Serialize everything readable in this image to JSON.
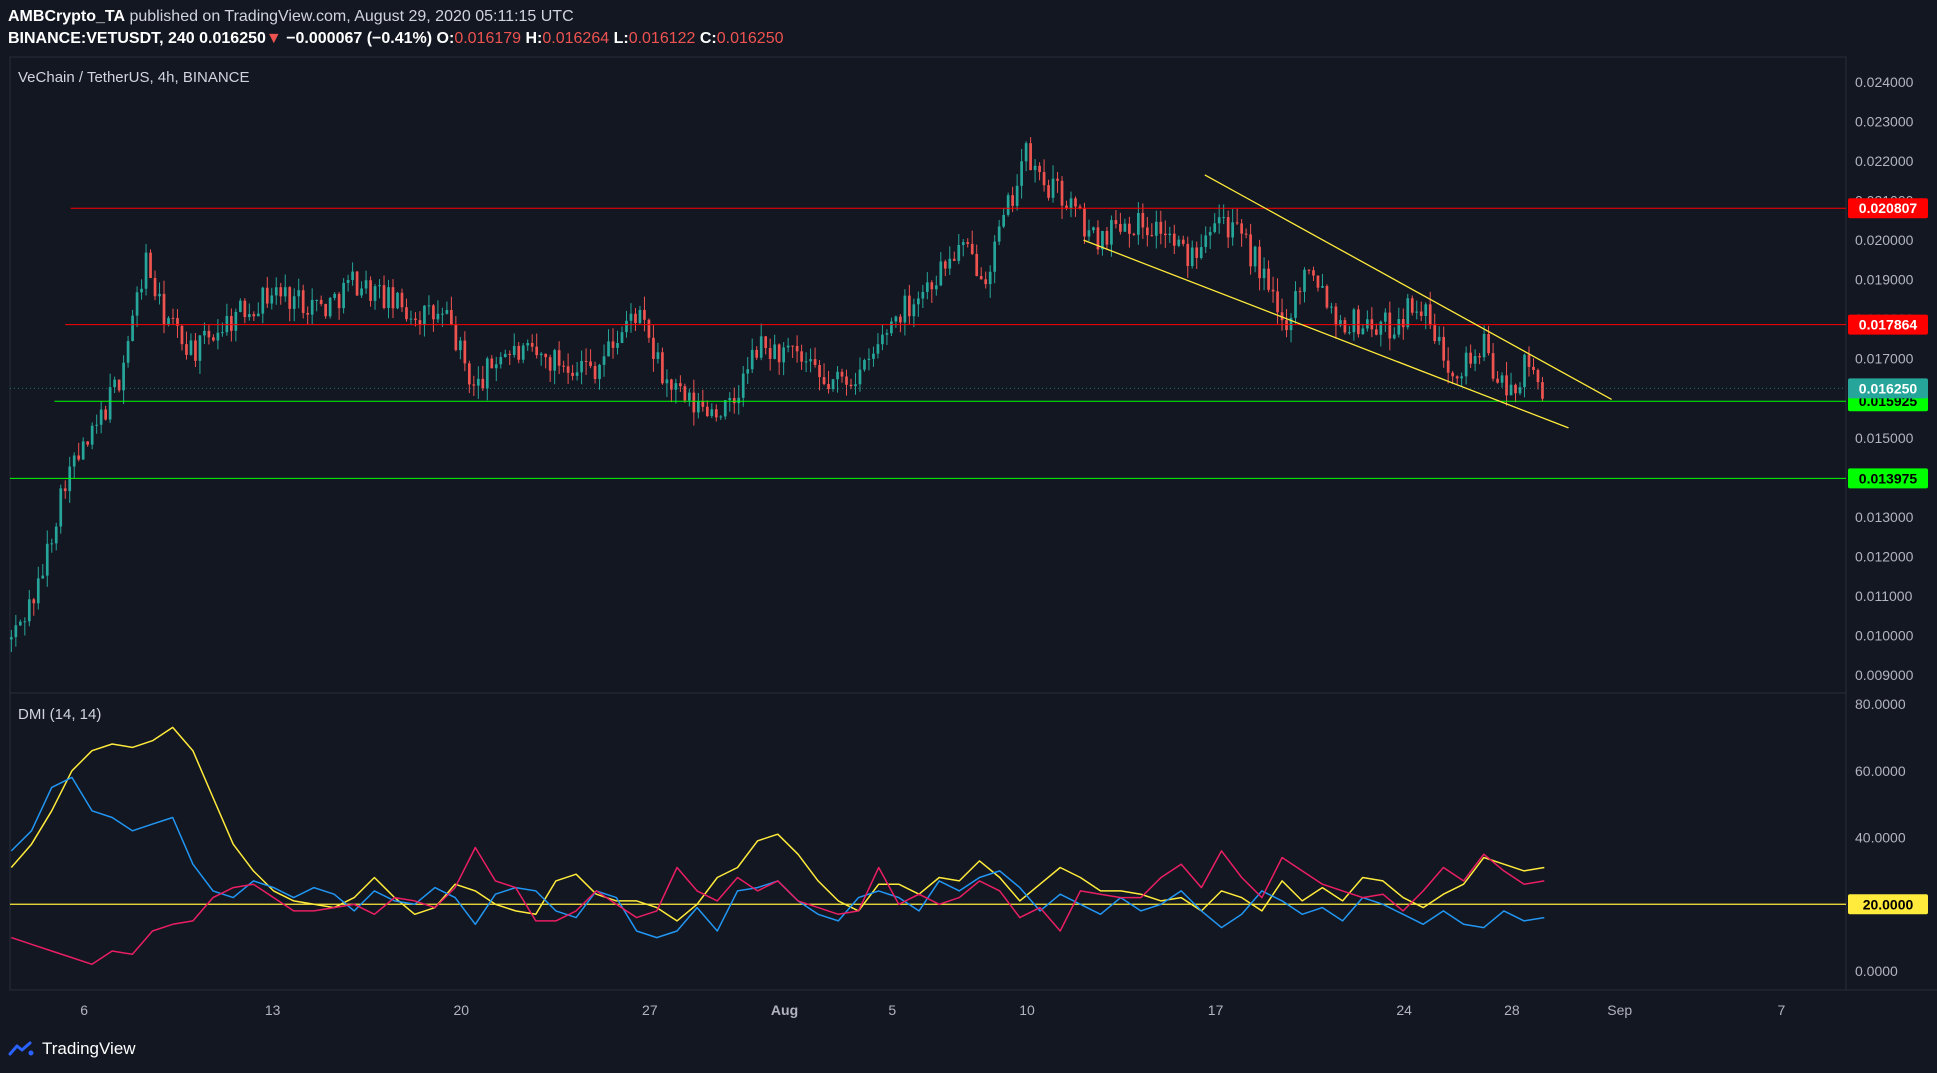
{
  "header": {
    "author": "AMBCrypto_TA",
    "published_text": "published on TradingView.com, August 29, 2020 05:11:15 UTC",
    "symbol": "BINANCE:VETUSDT, 240",
    "last": "0.016250",
    "arrow": "▼",
    "change": "−0.000067 (−0.41%)",
    "o_label": "O:",
    "o": "0.016179",
    "h_label": "H:",
    "h": "0.016264",
    "l_label": "L:",
    "l": "0.016122",
    "c_label": "C:",
    "c": "0.016250"
  },
  "footer": {
    "brand": "TradingView"
  },
  "chart_data": [
    {
      "type": "candlestick",
      "title": "VeChain / TetherUS, 4h, BINANCE",
      "ylim": [
        0.0085,
        0.0247
      ],
      "y_ticks": [
        "0.024000",
        "0.023000",
        "0.022000",
        "0.021000",
        "0.020000",
        "0.019000",
        "0.018000",
        "0.017000",
        "0.016000",
        "0.015000",
        "0.014000",
        "0.013000",
        "0.012000",
        "0.011000",
        "0.010000",
        "0.009000"
      ],
      "x_ticks": [
        {
          "label": "6",
          "day": 6
        },
        {
          "label": "13",
          "day": 13
        },
        {
          "label": "20",
          "day": 20
        },
        {
          "label": "27",
          "day": 27
        },
        {
          "label": "Aug",
          "day": 32
        },
        {
          "label": "5",
          "day": 36
        },
        {
          "label": "10",
          "day": 41
        },
        {
          "label": "17",
          "day": 48
        },
        {
          "label": "24",
          "day": 55
        },
        {
          "label": "28",
          "day": 59
        },
        {
          "label": "Sep",
          "day": 63
        },
        {
          "label": "7",
          "day": 69
        }
      ],
      "x_range_days": [
        3.25,
        71.4
      ],
      "up_color": "#26a69a",
      "down_color": "#ef5350",
      "key_points": [
        {
          "day": 3.3,
          "price": 0.0099
        },
        {
          "day": 4.3,
          "price": 0.0112
        },
        {
          "day": 5.3,
          "price": 0.014
        },
        {
          "day": 6.3,
          "price": 0.015
        },
        {
          "day": 7.3,
          "price": 0.0165
        },
        {
          "day": 8.3,
          "price": 0.0195
        },
        {
          "day": 8.8,
          "price": 0.0183
        },
        {
          "day": 9.6,
          "price": 0.0175
        },
        {
          "day": 10.2,
          "price": 0.0172
        },
        {
          "day": 11.0,
          "price": 0.0178
        },
        {
          "day": 13.0,
          "price": 0.0187
        },
        {
          "day": 15.0,
          "price": 0.0183
        },
        {
          "day": 16.0,
          "price": 0.019
        },
        {
          "day": 18.0,
          "price": 0.0182
        },
        {
          "day": 19.5,
          "price": 0.018
        },
        {
          "day": 20.5,
          "price": 0.0162
        },
        {
          "day": 21.5,
          "price": 0.0172
        },
        {
          "day": 23.0,
          "price": 0.017
        },
        {
          "day": 25.0,
          "price": 0.0168
        },
        {
          "day": 26.5,
          "price": 0.0182
        },
        {
          "day": 27.5,
          "price": 0.0165
        },
        {
          "day": 28.5,
          "price": 0.0158
        },
        {
          "day": 30.0,
          "price": 0.0157
        },
        {
          "day": 31.0,
          "price": 0.0173
        },
        {
          "day": 32.5,
          "price": 0.017
        },
        {
          "day": 33.5,
          "price": 0.0163
        },
        {
          "day": 35.0,
          "price": 0.0167
        },
        {
          "day": 36.0,
          "price": 0.018
        },
        {
          "day": 37.5,
          "price": 0.019
        },
        {
          "day": 38.5,
          "price": 0.0198
        },
        {
          "day": 39.5,
          "price": 0.0192
        },
        {
          "day": 40.4,
          "price": 0.021
        },
        {
          "day": 40.9,
          "price": 0.0222
        },
        {
          "day": 41.5,
          "price": 0.0215
        },
        {
          "day": 42.5,
          "price": 0.021
        },
        {
          "day": 43.5,
          "price": 0.02
        },
        {
          "day": 44.5,
          "price": 0.0205
        },
        {
          "day": 46.0,
          "price": 0.0203
        },
        {
          "day": 47.0,
          "price": 0.0195
        },
        {
          "day": 48.0,
          "price": 0.0208
        },
        {
          "day": 49.5,
          "price": 0.0195
        },
        {
          "day": 50.5,
          "price": 0.0178
        },
        {
          "day": 51.5,
          "price": 0.0195
        },
        {
          "day": 52.5,
          "price": 0.018
        },
        {
          "day": 54.5,
          "price": 0.0178
        },
        {
          "day": 55.5,
          "price": 0.0185
        },
        {
          "day": 56.5,
          "price": 0.017
        },
        {
          "day": 57.0,
          "price": 0.0168
        },
        {
          "day": 58.0,
          "price": 0.0173
        },
        {
          "day": 58.8,
          "price": 0.016
        },
        {
          "day": 59.5,
          "price": 0.0168
        },
        {
          "day": 60.2,
          "price": 0.01625
        }
      ],
      "lines": [
        {
          "name": "resistance-1",
          "price": 0.020807,
          "label": "0.020807",
          "color": "#ff0000",
          "from_day": 5.5
        },
        {
          "name": "resistance-2",
          "price": 0.017864,
          "label": "0.017864",
          "color": "#ff0000",
          "from_day": 5.3
        },
        {
          "name": "support-1",
          "price": 0.015925,
          "label": "0.015925",
          "color": "#00ff00",
          "from_day": 4.9
        },
        {
          "name": "support-2",
          "price": 0.013975,
          "label": "0.013975",
          "color": "#00ff00",
          "from_day": 3.25
        }
      ],
      "trendlines": [
        {
          "name": "upper",
          "from": {
            "day": 47.6,
            "price": 0.02165
          },
          "to": {
            "day": 62.7,
            "price": 0.01597
          },
          "color": "#ffeb3b"
        },
        {
          "name": "lower",
          "from": {
            "day": 43.1,
            "price": 0.02
          },
          "to": {
            "day": 61.1,
            "price": 0.01525
          },
          "color": "#ffeb3b"
        }
      ],
      "last_price": {
        "value": 0.01625,
        "label": "0.016250",
        "color": "#26a69a"
      }
    },
    {
      "type": "line",
      "title": "DMI (14, 14)",
      "ylim": [
        -6,
        82
      ],
      "y_ticks": [
        "80.0000",
        "60.0000",
        "40.0000",
        "0.0000"
      ],
      "level": {
        "value": 20,
        "label": "20.0000",
        "color": "#ffeb3b"
      },
      "series": [
        {
          "color": "#ffeb3b",
          "values": [
            31,
            38,
            48,
            60,
            66,
            68,
            67,
            69,
            73,
            66,
            52,
            38,
            30,
            24,
            21,
            20,
            19,
            22,
            28,
            22,
            17,
            19,
            26,
            24,
            20,
            18,
            17,
            27,
            29,
            23,
            21,
            21,
            19,
            15,
            20,
            28,
            31,
            39,
            41,
            35,
            27,
            21,
            18,
            26,
            26,
            23,
            28,
            27,
            33,
            28,
            21,
            26,
            31,
            28,
            24,
            24,
            23,
            21,
            22,
            18,
            24,
            22,
            18,
            27,
            21,
            25,
            21,
            28,
            27,
            22,
            19,
            23,
            26,
            34,
            32,
            30,
            31
          ]
        },
        {
          "color": "#2196f3",
          "values": [
            36,
            42,
            55,
            58,
            48,
            46,
            42,
            44,
            46,
            32,
            24,
            22,
            27,
            25,
            22,
            25,
            23,
            18,
            24,
            21,
            20,
            25,
            22,
            14,
            23,
            25,
            24,
            18,
            16,
            24,
            22,
            12,
            10,
            12,
            19,
            12,
            24,
            25,
            27,
            21,
            17,
            15,
            22,
            24,
            22,
            18,
            27,
            24,
            28,
            30,
            25,
            18,
            23,
            20,
            17,
            22,
            18,
            20,
            24,
            18,
            13,
            17,
            24,
            21,
            17,
            19,
            15,
            22,
            20,
            17,
            14,
            18,
            14,
            13,
            18,
            15,
            16
          ]
        },
        {
          "color": "#e91e63",
          "values": [
            10,
            8,
            6,
            4,
            2,
            6,
            5,
            12,
            14,
            15,
            22,
            25,
            26,
            22,
            18,
            18,
            19,
            20,
            17,
            22,
            21,
            19,
            25,
            37,
            27,
            25,
            15,
            15,
            18,
            24,
            20,
            16,
            18,
            31,
            24,
            21,
            28,
            24,
            27,
            21,
            19,
            17,
            18,
            31,
            20,
            23,
            20,
            22,
            27,
            24,
            16,
            19,
            12,
            24,
            23,
            22,
            22,
            28,
            32,
            25,
            36,
            28,
            22,
            34,
            30,
            26,
            24,
            22,
            23,
            18,
            24,
            31,
            27,
            35,
            30,
            26,
            27
          ]
        }
      ]
    }
  ]
}
